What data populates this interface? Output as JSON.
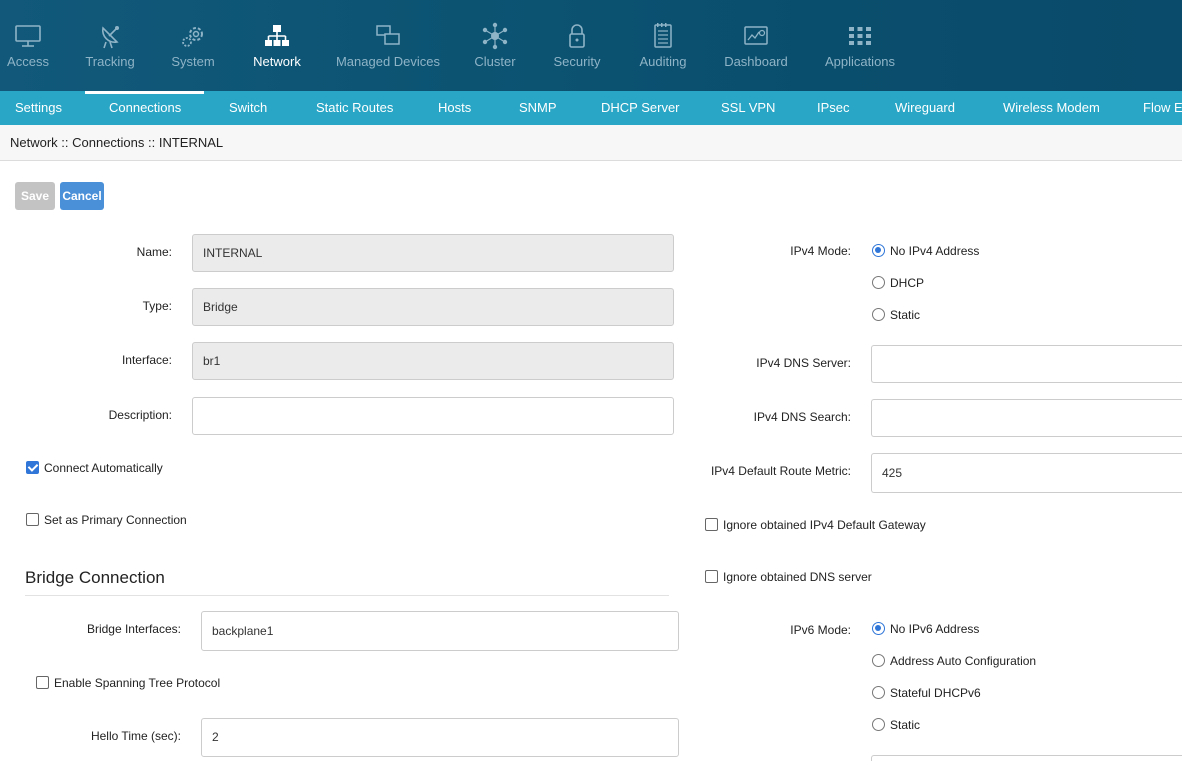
{
  "topnav": [
    {
      "label": "Access",
      "icon": "monitor-icon"
    },
    {
      "label": "Tracking",
      "icon": "satellite-dish-icon"
    },
    {
      "label": "System",
      "icon": "gears-icon"
    },
    {
      "label": "Network",
      "icon": "network-icon",
      "active": true
    },
    {
      "label": "Managed Devices",
      "icon": "devices-icon"
    },
    {
      "label": "Cluster",
      "icon": "cluster-icon"
    },
    {
      "label": "Security",
      "icon": "lock-icon"
    },
    {
      "label": "Auditing",
      "icon": "notepad-icon"
    },
    {
      "label": "Dashboard",
      "icon": "dashboard-icon"
    },
    {
      "label": "Applications",
      "icon": "grid-icon"
    }
  ],
  "subnav": [
    {
      "label": "Settings"
    },
    {
      "label": "Connections",
      "active": true
    },
    {
      "label": "Switch"
    },
    {
      "label": "Static Routes"
    },
    {
      "label": "Hosts"
    },
    {
      "label": "SNMP"
    },
    {
      "label": "DHCP Server"
    },
    {
      "label": "SSL VPN"
    },
    {
      "label": "IPsec"
    },
    {
      "label": "Wireguard"
    },
    {
      "label": "Wireless Modem"
    },
    {
      "label": "Flow Ex"
    }
  ],
  "breadcrumb": "Network :: Connections :: INTERNAL",
  "buttons": {
    "save": "Save",
    "cancel": "Cancel"
  },
  "left": {
    "name_label": "Name:",
    "name_value": "INTERNAL",
    "type_label": "Type:",
    "type_value": "Bridge",
    "interface_label": "Interface:",
    "interface_value": "br1",
    "description_label": "Description:",
    "description_value": "",
    "connect_auto_label": "Connect Automatically",
    "connect_auto_checked": true,
    "primary_label": "Set as Primary Connection",
    "primary_checked": false
  },
  "bridge": {
    "title": "Bridge Connection",
    "interfaces_label": "Bridge Interfaces:",
    "interfaces_value": "backplane1",
    "stp_label": "Enable Spanning Tree Protocol",
    "stp_checked": false,
    "hello_label": "Hello Time (sec):",
    "hello_value": "2"
  },
  "right": {
    "ipv4_mode_label": "IPv4 Mode:",
    "ipv4_options": [
      "No IPv4 Address",
      "DHCP",
      "Static"
    ],
    "ipv4_selected": "No IPv4 Address",
    "dns_server_label": "IPv4 DNS Server:",
    "dns_server_value": "",
    "dns_search_label": "IPv4 DNS Search:",
    "dns_search_value": "",
    "metric_label": "IPv4 Default Route Metric:",
    "metric_value": "425",
    "ignore_gw_label": "Ignore obtained IPv4 Default Gateway",
    "ignore_gw_checked": false,
    "ignore_dns_label": "Ignore obtained DNS server",
    "ignore_dns_checked": false,
    "ipv6_mode_label": "IPv6 Mode:",
    "ipv6_options": [
      "No IPv6 Address",
      "Address Auto Configuration",
      "Stateful DHCPv6",
      "Static"
    ],
    "ipv6_selected": "No IPv6 Address"
  },
  "colors": {
    "topnav_bg": "#0c5372",
    "subnav_bg": "#29a6c5",
    "accent": "#2f76d8",
    "cancel_btn": "#4a90d9",
    "save_btn_disabled": "#c3c3c3"
  }
}
